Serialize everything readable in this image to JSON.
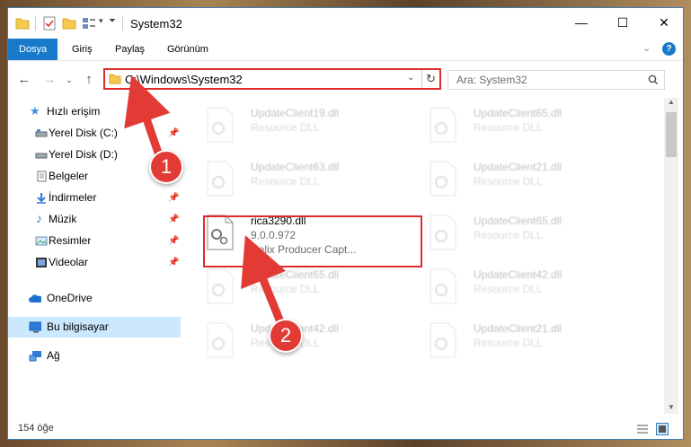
{
  "window": {
    "title": "System32",
    "buttons": {
      "minimize": "—",
      "maximize": "☐",
      "close": "✕"
    }
  },
  "ribbon": {
    "tabs": [
      "Dosya",
      "Giriş",
      "Paylaş",
      "Görünüm"
    ],
    "active_tab": "Dosya",
    "accent": "#1979ca"
  },
  "address": {
    "path": "C:\\Windows\\System32",
    "search_placeholder": "Ara: System32"
  },
  "nav": {
    "quick_access": "Hızlı erişim",
    "items": [
      {
        "label": "Yerel Disk (C:)",
        "icon": "drive-icon",
        "pinned": true
      },
      {
        "label": "Yerel Disk (D:)",
        "icon": "drive-icon",
        "pinned": false
      },
      {
        "label": "Belgeler",
        "icon": "documents-icon",
        "pinned": true
      },
      {
        "label": "İndirmeler",
        "icon": "downloads-icon",
        "pinned": true
      },
      {
        "label": "Müzik",
        "icon": "music-icon",
        "pinned": true
      },
      {
        "label": "Resimler",
        "icon": "pictures-icon",
        "pinned": true
      },
      {
        "label": "Videolar",
        "icon": "videos-icon",
        "pinned": true
      }
    ],
    "onedrive": "OneDrive",
    "this_pc": "Bu bilgisayar",
    "network": "Ağ"
  },
  "files": [
    {
      "name": "UpdateClient19.dll",
      "line2": "Resource DLL",
      "line3": ""
    },
    {
      "name": "UpdateClient65.dll",
      "line2": "Resource DLL",
      "line3": ""
    },
    {
      "name": "UpdateClient63.dll",
      "line2": "Resource DLL",
      "line3": ""
    },
    {
      "name": "UpdateClient21.dll",
      "line2": "Resource DLL",
      "line3": ""
    },
    {
      "name": "rica3290.dll",
      "line2": "9.0.0.972",
      "line3": "Helix Producer Capt..."
    },
    {
      "name": "UpdateClient65.dll",
      "line2": "Resource DLL",
      "line3": ""
    },
    {
      "name": "UpdateClient65.dll",
      "line2": "Resource DLL",
      "line3": ""
    },
    {
      "name": "UpdateClient42.dll",
      "line2": "Resource DLL",
      "line3": ""
    },
    {
      "name": "UpdateClient42.dll",
      "line2": "Resource DLL",
      "line3": ""
    },
    {
      "name": "UpdateClient21.dll",
      "line2": "Resource DLL",
      "line3": ""
    }
  ],
  "status": {
    "count": "154 öğe"
  },
  "annotations": {
    "step1": "1",
    "step2": "2",
    "color": "#e23b35"
  }
}
